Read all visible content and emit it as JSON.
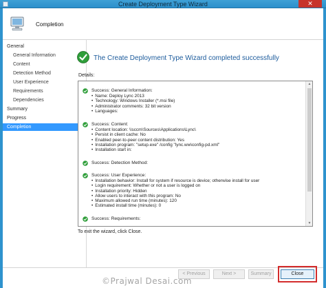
{
  "window": {
    "title": "Create Deployment Type Wizard",
    "close_glyph": "✕"
  },
  "header": {
    "title": "Completion"
  },
  "sidebar": {
    "items": [
      {
        "label": "General"
      },
      {
        "label": "General Information"
      },
      {
        "label": "Content"
      },
      {
        "label": "Detection Method"
      },
      {
        "label": "User Experience"
      },
      {
        "label": "Requirements"
      },
      {
        "label": "Dependencies"
      },
      {
        "label": "Summary"
      },
      {
        "label": "Progress"
      },
      {
        "label": "Completion"
      }
    ]
  },
  "main": {
    "success_message": "The Create Deployment Type Wizard completed successfully",
    "details_label": "Details:",
    "exit_text": "To exit the wizard, click Close."
  },
  "details": {
    "general": {
      "head": "Success: General Information:",
      "items": [
        "Name: Deploy Lync 2013",
        "Technology: Windows Installer (*.msi file)",
        "Administrator comments:  32 bit version",
        "Languages:"
      ]
    },
    "content": {
      "head": "Success: Content:",
      "items": [
        "Content location: \\\\sccm\\Sources\\Applications\\Lync\\",
        "Persist in client cache: No",
        "Enabled peer-to-peer content distribution: Yes",
        "Installation program: \"setup.exe\" /config \"lync.ww\\config-pd.xml\"",
        "Installation start in:"
      ]
    },
    "detection": {
      "head": "Success: Detection Method:"
    },
    "user_experience": {
      "head": "Success: User Experience:",
      "items": [
        "Installation behavior: Install for system if resource is device; otherwise install for user",
        "Login requirement: Whether or not a user is logged on",
        "Installation priority: Hidden",
        "Allow users to interact with this program: No",
        "Maximum allowed run time (minutes): 120",
        "Estimated install time (minutes): 0"
      ]
    },
    "requirements": {
      "head": "Success: Requirements:"
    }
  },
  "buttons": {
    "previous": "< Previous",
    "next": "Next >",
    "summary": "Summary",
    "close": "Close"
  },
  "watermark": "©Prajwal Desai.com",
  "colors": {
    "accent": "#3399ff",
    "success_text": "#1c5b9c",
    "highlight": "#d32b2b",
    "titlebar": "#2b8fcb"
  }
}
